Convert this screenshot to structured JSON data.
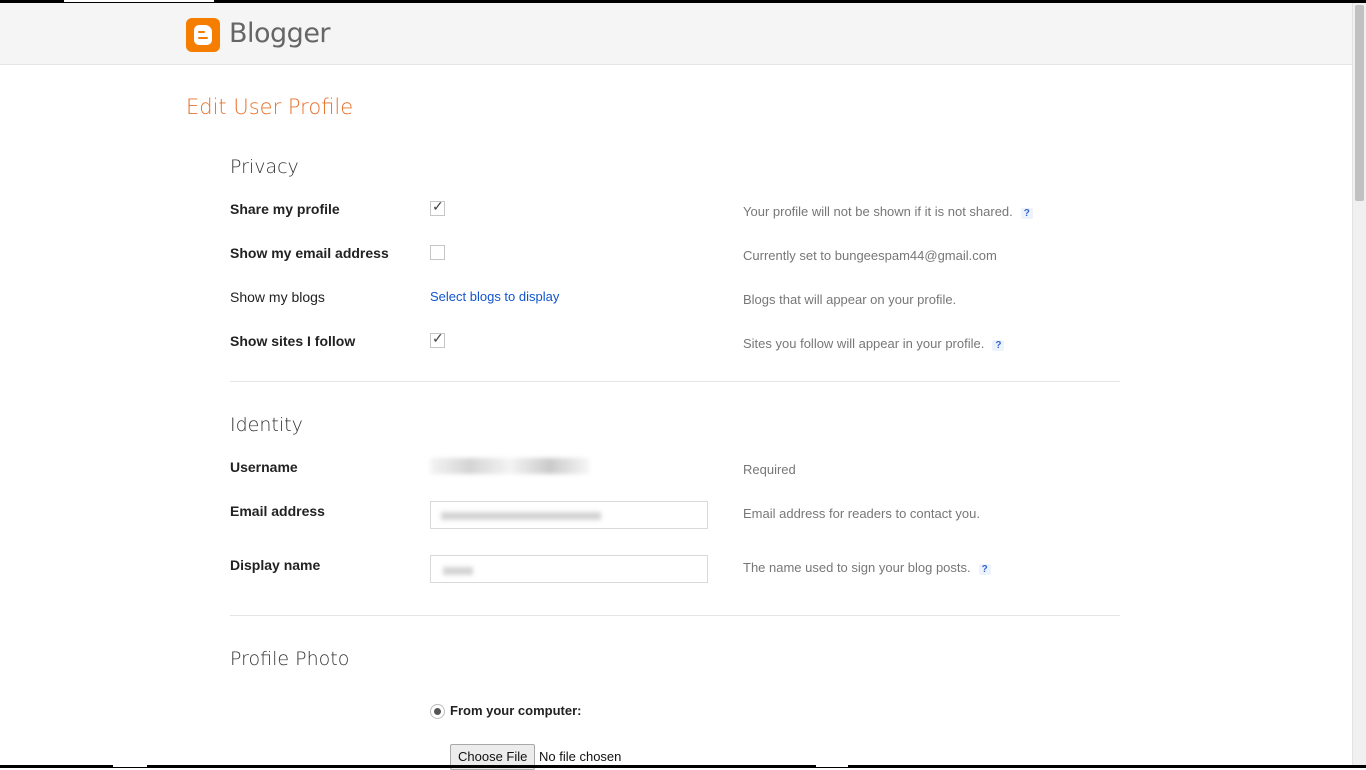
{
  "app": {
    "name": "Blogger"
  },
  "page": {
    "title": "Edit User Profile"
  },
  "privacy": {
    "section_title": "Privacy",
    "rows": {
      "share_profile": {
        "label": "Share my profile",
        "checked": true,
        "help": "Your profile will not be shown if it is not shared.",
        "help_icon": "?"
      },
      "show_email": {
        "label": "Show my email address",
        "checked": false,
        "help": "Currently set to bungeespam44@gmail.com"
      },
      "show_blogs": {
        "label": "Show my blogs",
        "link": "Select blogs to display",
        "help": "Blogs that will appear on your profile."
      },
      "show_sites": {
        "label": "Show sites I follow",
        "checked": true,
        "help": "Sites you follow will appear in your profile.",
        "help_icon": "?"
      }
    }
  },
  "identity": {
    "section_title": "Identity",
    "username": {
      "label": "Username",
      "help": "Required"
    },
    "email": {
      "label": "Email address",
      "help": "Email address for readers to contact you."
    },
    "display_name": {
      "label": "Display name",
      "help": "The name used to sign your blog posts.",
      "help_icon": "?"
    }
  },
  "profile_photo": {
    "section_title": "Profile Photo",
    "from_computer": {
      "label": "From your computer:",
      "selected": true
    },
    "file_button": "Choose File",
    "file_status": "No file chosen"
  },
  "colors": {
    "accent": "#e8702a",
    "brand": "#f57d00",
    "link": "#1155cc"
  },
  "icons": {
    "logo": "blogger-logo-icon",
    "check": "checkmark-icon",
    "help": "help-question-icon"
  }
}
